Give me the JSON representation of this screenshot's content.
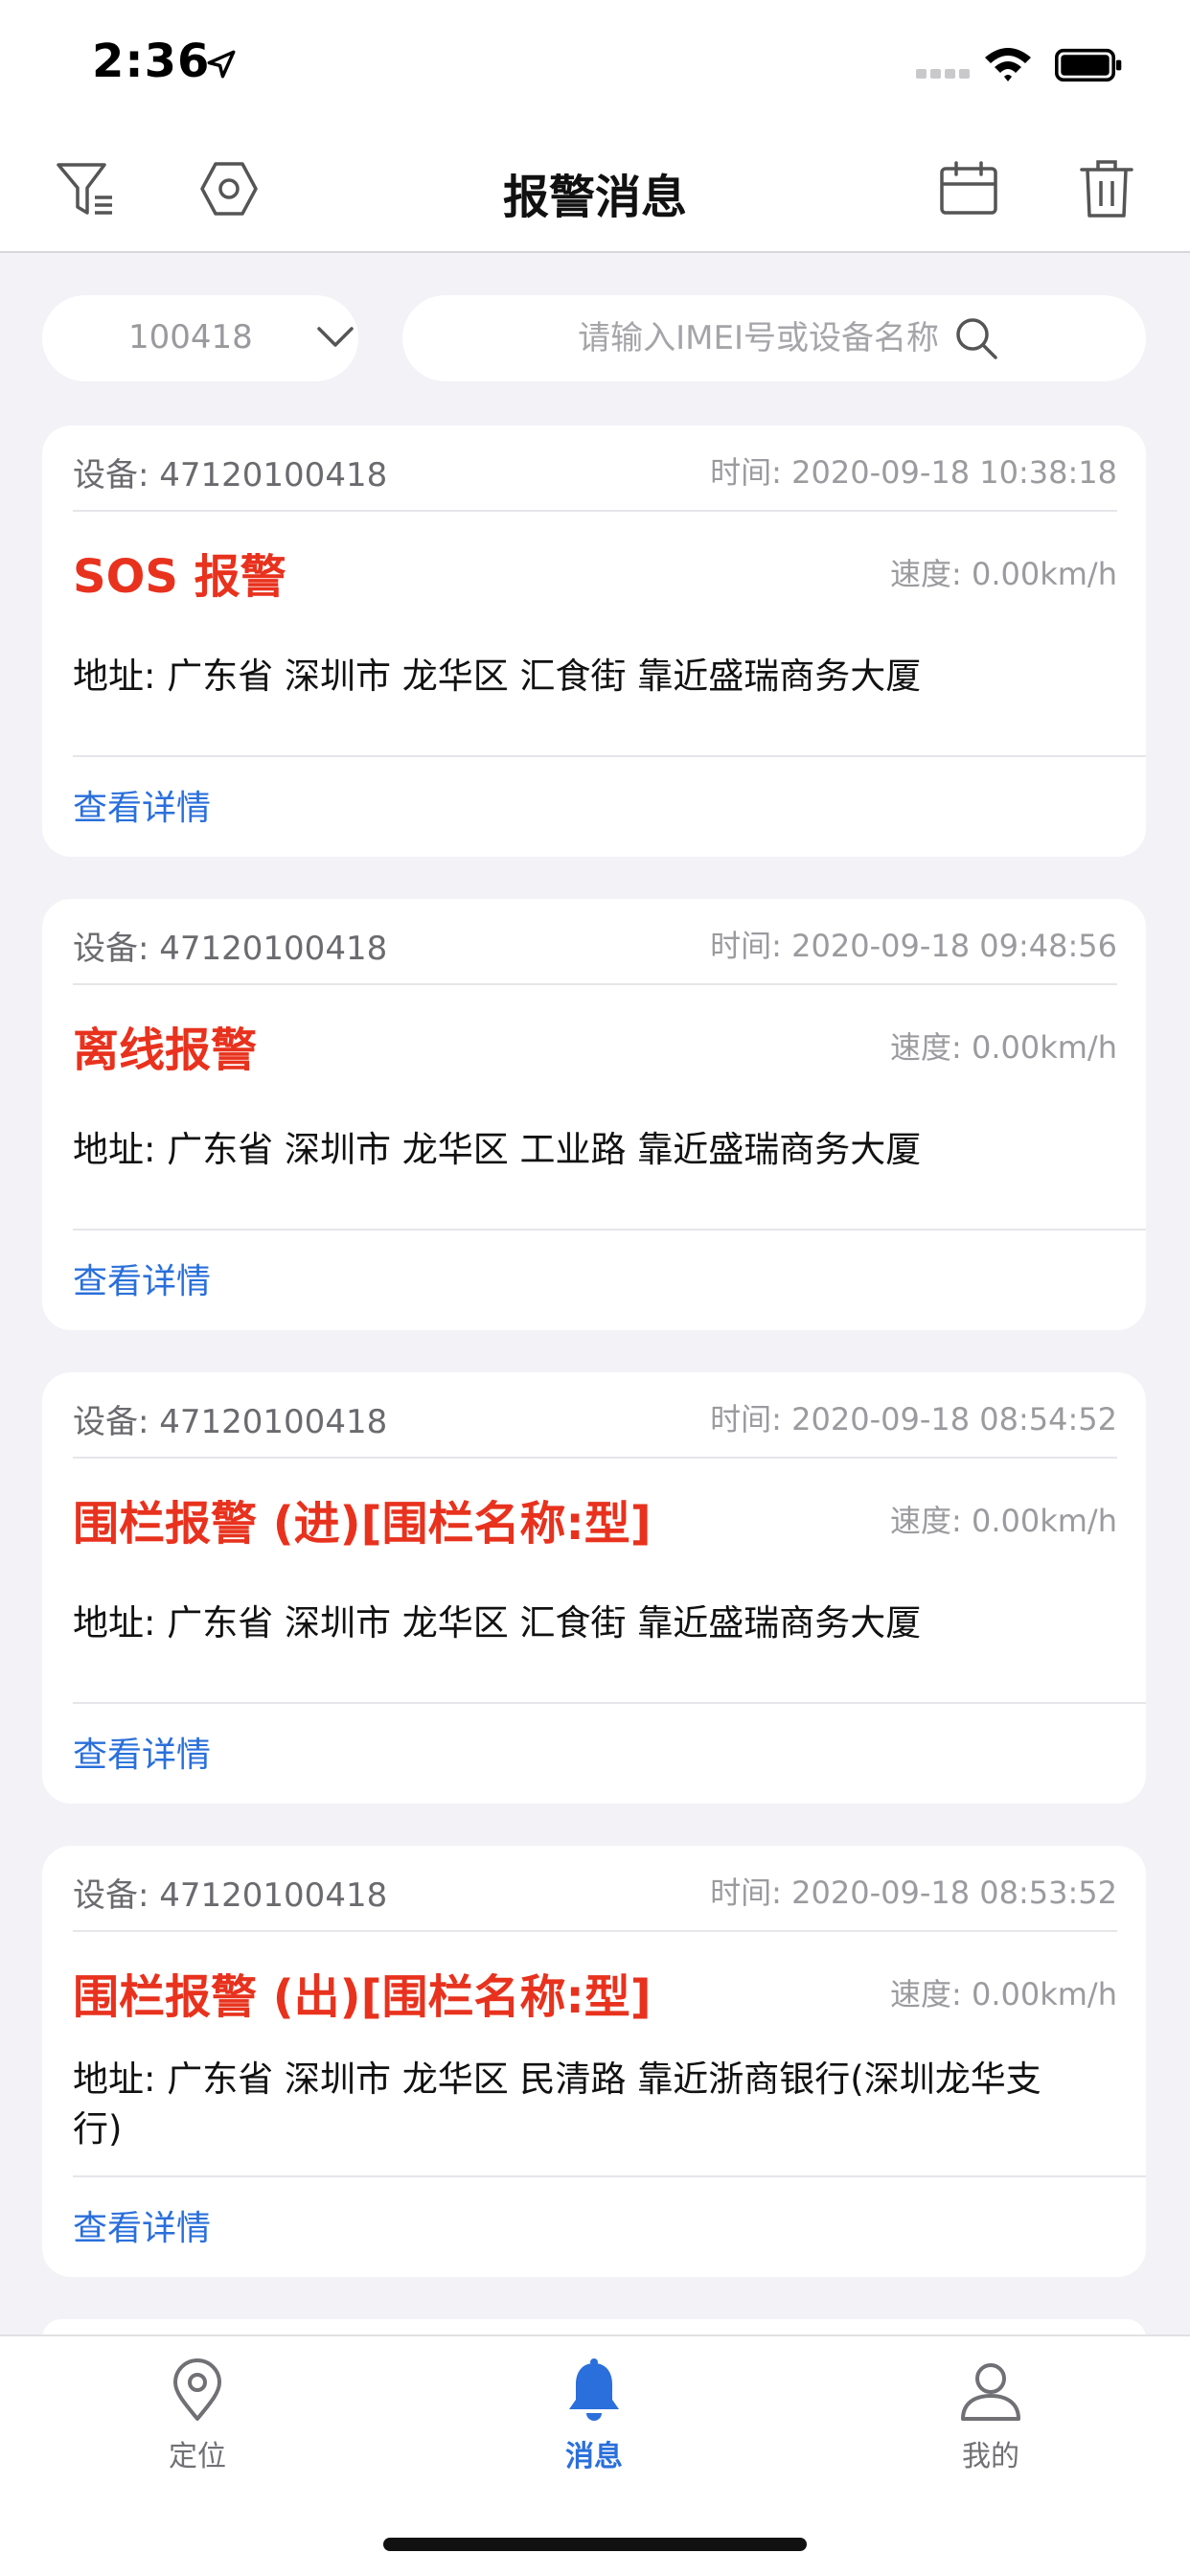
{
  "status": {
    "time": "2:36"
  },
  "header": {
    "title": "报警消息"
  },
  "filter": {
    "device_value": "100418",
    "search_placeholder": "请输入IMEI号或设备名称"
  },
  "alarms": [
    {
      "device": "设备: 47120100418",
      "time": "时间: 2020-09-18 10:38:18",
      "title": "SOS 报警",
      "speed": "速度: 0.00km/h",
      "address": "地址: 广东省 深圳市 龙华区 汇食街 靠近盛瑞商务大厦",
      "detail": "查看详情"
    },
    {
      "device": "设备: 47120100418",
      "time": "时间: 2020-09-18 09:48:56",
      "title": "离线报警",
      "speed": "速度: 0.00km/h",
      "address": "地址: 广东省 深圳市 龙华区 工业路 靠近盛瑞商务大厦",
      "detail": "查看详情"
    },
    {
      "device": "设备: 47120100418",
      "time": "时间: 2020-09-18 08:54:52",
      "title": "围栏报警 (进)[围栏名称:型]",
      "speed": "速度: 0.00km/h",
      "address": "地址: 广东省 深圳市 龙华区 汇食街 靠近盛瑞商务大厦",
      "detail": "查看详情"
    },
    {
      "device": "设备: 47120100418",
      "time": "时间: 2020-09-18 08:53:52",
      "title": "围栏报警 (出)[围栏名称:型]",
      "speed": "速度: 0.00km/h",
      "address": "地址: 广东省 深圳市 龙华区 民清路 靠近浙商银行(深圳龙华支行)",
      "detail": "查看详情"
    }
  ],
  "tabs": [
    {
      "label": "定位",
      "icon": "location-pin-icon"
    },
    {
      "label": "消息",
      "icon": "bell-icon"
    },
    {
      "label": "我的",
      "icon": "user-icon"
    }
  ],
  "colors": {
    "alarm_red": "#e8321e",
    "link_blue": "#2a6fdb",
    "background": "#f2f2f7"
  }
}
